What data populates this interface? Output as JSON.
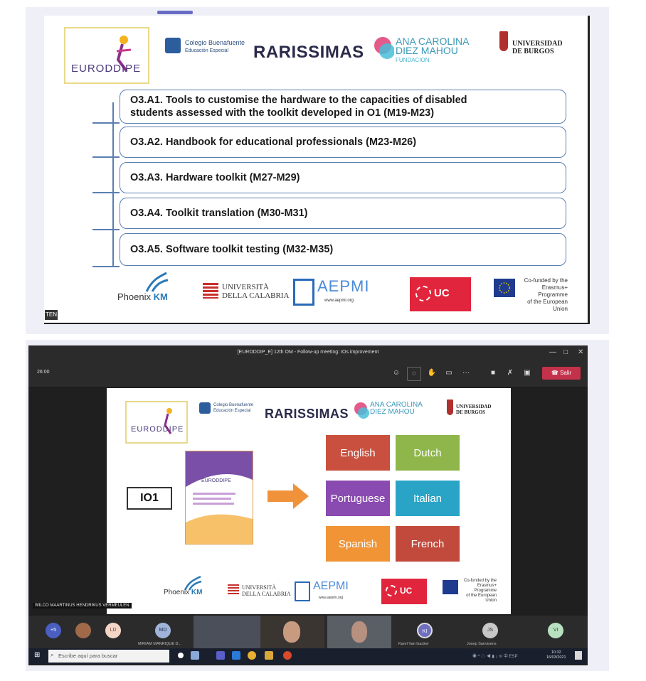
{
  "top_slide": {
    "logos": {
      "euroddipe": "EURODDIPE",
      "colegio_line1": "Colegio Buenafuente",
      "colegio_line2": "Educación Especial",
      "rarissimas": "RARISSIMAS",
      "fundacion_line1": "ANA CAROLINA",
      "fundacion_line2": "DIEZ MAHOU",
      "fundacion_sub": "FUNDACION",
      "ubu_line1": "UNIVERSIDAD",
      "ubu_line2": "DE BURGOS"
    },
    "activities": [
      {
        "line1": "O3.A1. Tools to customise the hardware to the capacities of disabled",
        "line2": "students assessed with the toolkit developed in O1 (M19-M23)"
      },
      {
        "line1": "O3.A2. Handbook for educational professionals (M23-M26)"
      },
      {
        "line1": "O3.A3. Hardware toolkit (M27-M29)"
      },
      {
        "line1": "O3.A4. Toolkit translation (M30-M31)"
      },
      {
        "line1": "O3.A5. Software toolkit testing (M32-M35)"
      }
    ],
    "footer": {
      "phoenix": "Phoenix",
      "km": "KM",
      "unical_line1": "UNIVERSITÀ",
      "unical_line2": "DELLA CALABRIA",
      "aepmi": "AEPMI",
      "aepmi_url": "www.aepmi.org",
      "uc": "UC",
      "eu_line1": "Co-funded by the",
      "eu_line2": "Erasmus+ Programme",
      "eu_line3": "of the European Union"
    },
    "corner_tag": "TEN"
  },
  "teams": {
    "window_title": "[EURODDIP_E] 12th OM - Follow-up meeting: IOs improvement",
    "timer": "26:00",
    "leave_label": "Salir",
    "slide": {
      "io_label": "IO1",
      "languages": [
        {
          "label": "English",
          "color": "#c9503e"
        },
        {
          "label": "Dutch",
          "color": "#8fb64a"
        },
        {
          "label": "Portuguese",
          "color": "#8a4bb0"
        },
        {
          "label": "Italian",
          "color": "#2aa4c6"
        },
        {
          "label": "Spanish",
          "color": "#f09436"
        },
        {
          "label": "French",
          "color": "#c14a3c"
        }
      ],
      "book_title": "EURODDIPE"
    },
    "presenter_name": "WILCO MAARTINUS HENDRIKUS VERMEULEN",
    "participants": [
      {
        "initials": "+5",
        "color": "#4a5fc1"
      },
      {
        "initials": "",
        "color": "#a06a4a"
      },
      {
        "initials": "LD",
        "color": "#f3d6c6"
      },
      {
        "initials": "MD",
        "color": "#9fb4d8",
        "label": "MIRIAM MANRIQUE D..."
      },
      {
        "initials": "KI",
        "color": "#6f6fc0",
        "label": "Karel Van Isacker"
      },
      {
        "initials": "JS",
        "color": "#c8c8c8",
        "label": "Josep Sanvisens"
      },
      {
        "initials": "VI",
        "color": "#b8e0c0",
        "label": ""
      }
    ],
    "taskbar": {
      "search_placeholder": "Escribe aquí para buscar",
      "time": "10:32",
      "date": "16/03/2021"
    }
  }
}
